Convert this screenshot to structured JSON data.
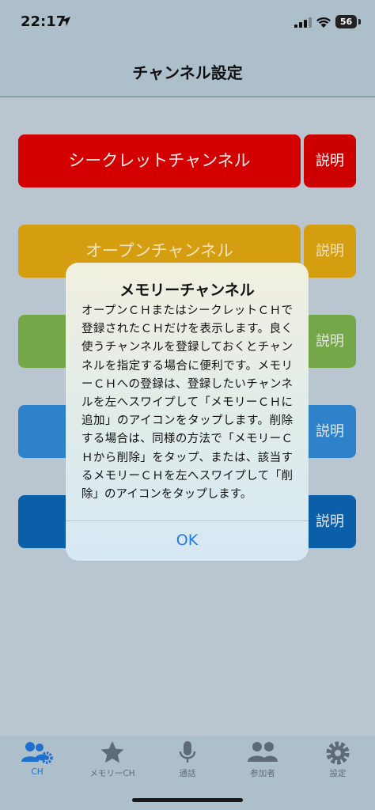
{
  "status": {
    "time": "22:17",
    "battery": "56"
  },
  "nav": {
    "title": "チャンネル設定"
  },
  "channels": [
    {
      "label": "シークレットチャンネル",
      "desc": "説明"
    },
    {
      "label": "オープンチャンネル",
      "desc": "説明"
    },
    {
      "label": "",
      "desc": "説明"
    },
    {
      "label": "",
      "desc": "説明"
    },
    {
      "label": "",
      "desc": "説明"
    }
  ],
  "dialog": {
    "title": "メモリーチャンネル",
    "message": "オープンＣＨまたはシークレットＣＨで登録されたＣＨだけを表示します。良く使うチャンネルを登録しておくとチャンネルを指定する場合に便利です。メモリーＣＨへの登録は、登録したいチャンネルを左へスワイプして「メモリーＣＨに追加」のアイコンをタップします。削除する場合は、同様の方法で「メモリーＣＨから削除」をタップ、または、該当するメモリーＣＨを左へスワイプして「削除」のアイコンをタップします。",
    "ok": "OK"
  },
  "tabs": [
    {
      "label": "CH",
      "icon": "users-gear-icon",
      "active": true
    },
    {
      "label": "メモリーCH",
      "icon": "star-icon",
      "active": false
    },
    {
      "label": "通話",
      "icon": "microphone-icon",
      "active": false
    },
    {
      "label": "参加者",
      "icon": "users-icon",
      "active": false
    },
    {
      "label": "設定",
      "icon": "gear-icon",
      "active": false
    }
  ],
  "colors": {
    "secret": "#d20000",
    "open": "#d59e10",
    "green": "#74a748",
    "blue": "#2d82c9",
    "darkblue": "#0b5ea8",
    "accent": "#1f6fd0"
  }
}
